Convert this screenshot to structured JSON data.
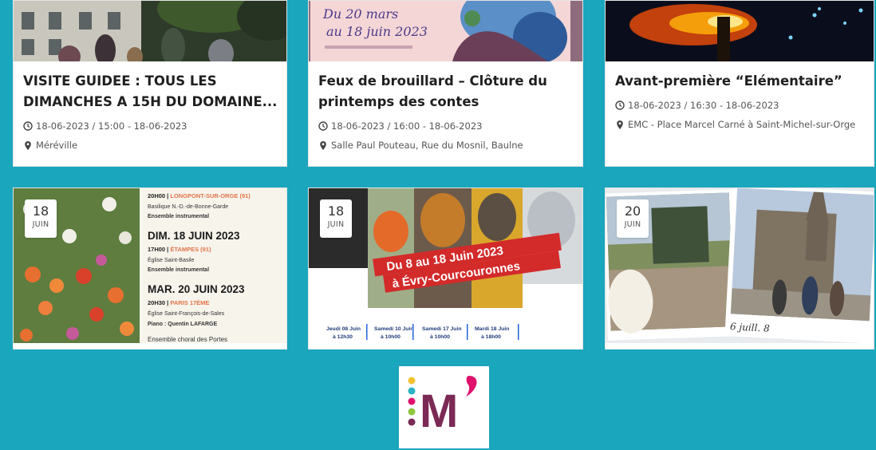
{
  "cards_top": [
    {
      "title": "VISITE GUIDEE : TOUS LES DIMANCHES A 15H DU DOMAINE...",
      "date": "18-06-2023 / 15:00 - 18-06-2023",
      "location": "Méréville"
    },
    {
      "title": "Feux de brouillard – Clôture du printemps des contes",
      "date": "18-06-2023 / 16:00 - 18-06-2023",
      "location": "Salle Paul Pouteau, Rue du Mosnil, Baulne",
      "poster_line1": "Du 20 mars",
      "poster_line2": "au 18 juin 2023"
    },
    {
      "title": "Avant-première “Elémentaire”",
      "date": "18-06-2023 / 16:30 - 18-06-2023",
      "location": "EMC - Place Marcel Carné à Saint-Michel-sur-Orge"
    }
  ],
  "cards_bottom": [
    {
      "day": "18",
      "month": "JUIN",
      "poster": {
        "l1a": "20H00 | ",
        "l1b": "LONGPONT-SUR-ORGE (91)",
        "l2": "Basilique N.-D.-de-Bonne-Garde",
        "l3": "Ensemble instrumental",
        "h1": "DIM. 18 JUIN 2023",
        "l4a": "17H00 | ",
        "l4b": "ÉTAMPES (91)",
        "l5": "Église Saint-Basile",
        "l6": "Ensemble instrumental",
        "h2": "MAR. 20 JUIN 2023",
        "l7a": "20H30 | ",
        "l7b": "PARIS 17ÈME",
        "l8": "Église Saint-François-de-Sales",
        "l9": "Piano : Quentin LAFARGE",
        "l10": "Ensemble choral des Portes"
      }
    },
    {
      "day": "18",
      "month": "JUIN",
      "banner1": "Du 8 au 18 Juin 2023",
      "banner2": "à Évry-Courcouronnes",
      "sessions": [
        {
          "d": "Jeudi 08 Juin",
          "t": "à 12h30"
        },
        {
          "d": "Samedi 10 Juin",
          "t": "à 10h00"
        },
        {
          "d": "Samedi 17 Juin",
          "t": "à 10h00"
        },
        {
          "d": "Mardi 18 Juin",
          "t": "à 18h00"
        }
      ]
    },
    {
      "day": "20",
      "month": "JUIN",
      "photo_caption": "6 juill. 8"
    }
  ],
  "logo": {
    "letter": "M"
  },
  "colors": {
    "teal": "#1aa6bd",
    "logo_purple": "#7b2a55",
    "logo_pink": "#e0106d"
  }
}
